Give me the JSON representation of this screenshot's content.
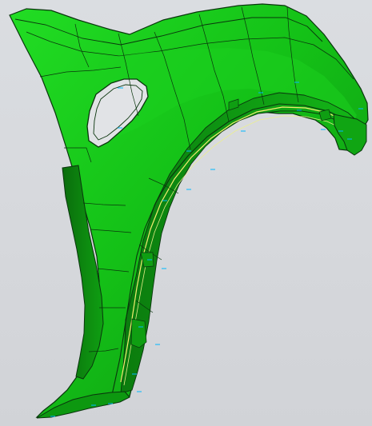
{
  "app": {
    "view_label": ""
  },
  "model": {
    "part_name": "",
    "colors": {
      "background_top": "#dadde1",
      "background_bottom": "#d1d3d7",
      "body_light": "#17d11a",
      "body_mid": "#10b514",
      "body_dark": "#0a7f0d",
      "edge": "#0b3c0d",
      "highlight_curve": "#f3f06a",
      "annotation": "#00b8ff"
    },
    "icons": [
      "surface-model-icon",
      "annotation-marker-icon"
    ]
  }
}
